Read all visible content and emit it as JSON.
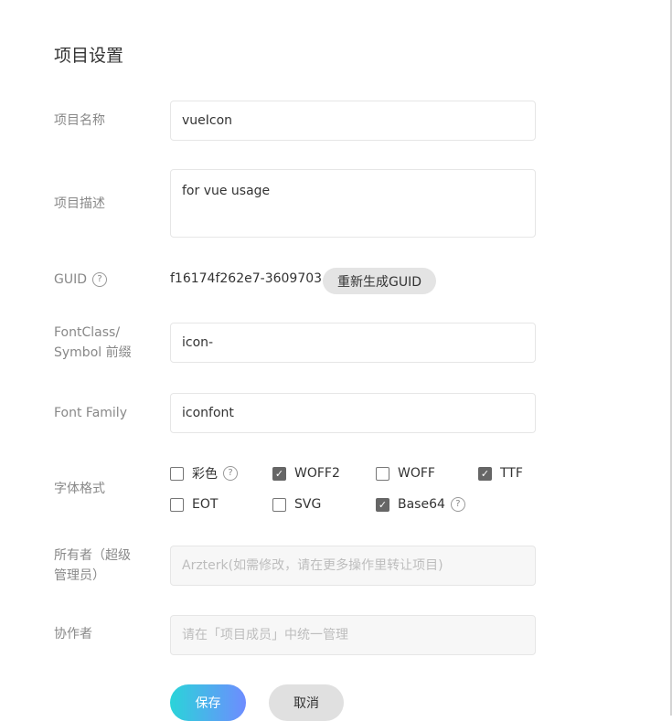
{
  "page": {
    "title": "项目设置"
  },
  "labels": {
    "name": "项目名称",
    "desc": "项目描述",
    "guid": "GUID",
    "prefix_line1": "FontClass/",
    "prefix_line2": "Symbol 前缀",
    "font_family": "Font Family",
    "formats": "字体格式",
    "owner_line1": "所有者（超级",
    "owner_line2": "管理员）",
    "collab": "协作者"
  },
  "fields": {
    "name": "vueIcon",
    "desc": "for vue usage",
    "guid": "f16174f262e7-3609703",
    "prefix": "icon-",
    "font_family": "iconfont",
    "owner_placeholder": "Arzterk(如需修改，请在更多操作里转让项目)",
    "collab_placeholder": "请在「项目成员」中统一管理"
  },
  "buttons": {
    "regen_guid": "重新生成GUID",
    "save": "保存",
    "cancel": "取消"
  },
  "help_icon": "?",
  "formats": [
    {
      "label": "彩色",
      "checked": false,
      "help": true
    },
    {
      "label": "WOFF2",
      "checked": true
    },
    {
      "label": "WOFF",
      "checked": false
    },
    {
      "label": "TTF",
      "checked": true
    },
    {
      "label": "EOT",
      "checked": false
    },
    {
      "label": "SVG",
      "checked": false
    },
    {
      "label": "Base64",
      "checked": true,
      "help": true
    }
  ]
}
